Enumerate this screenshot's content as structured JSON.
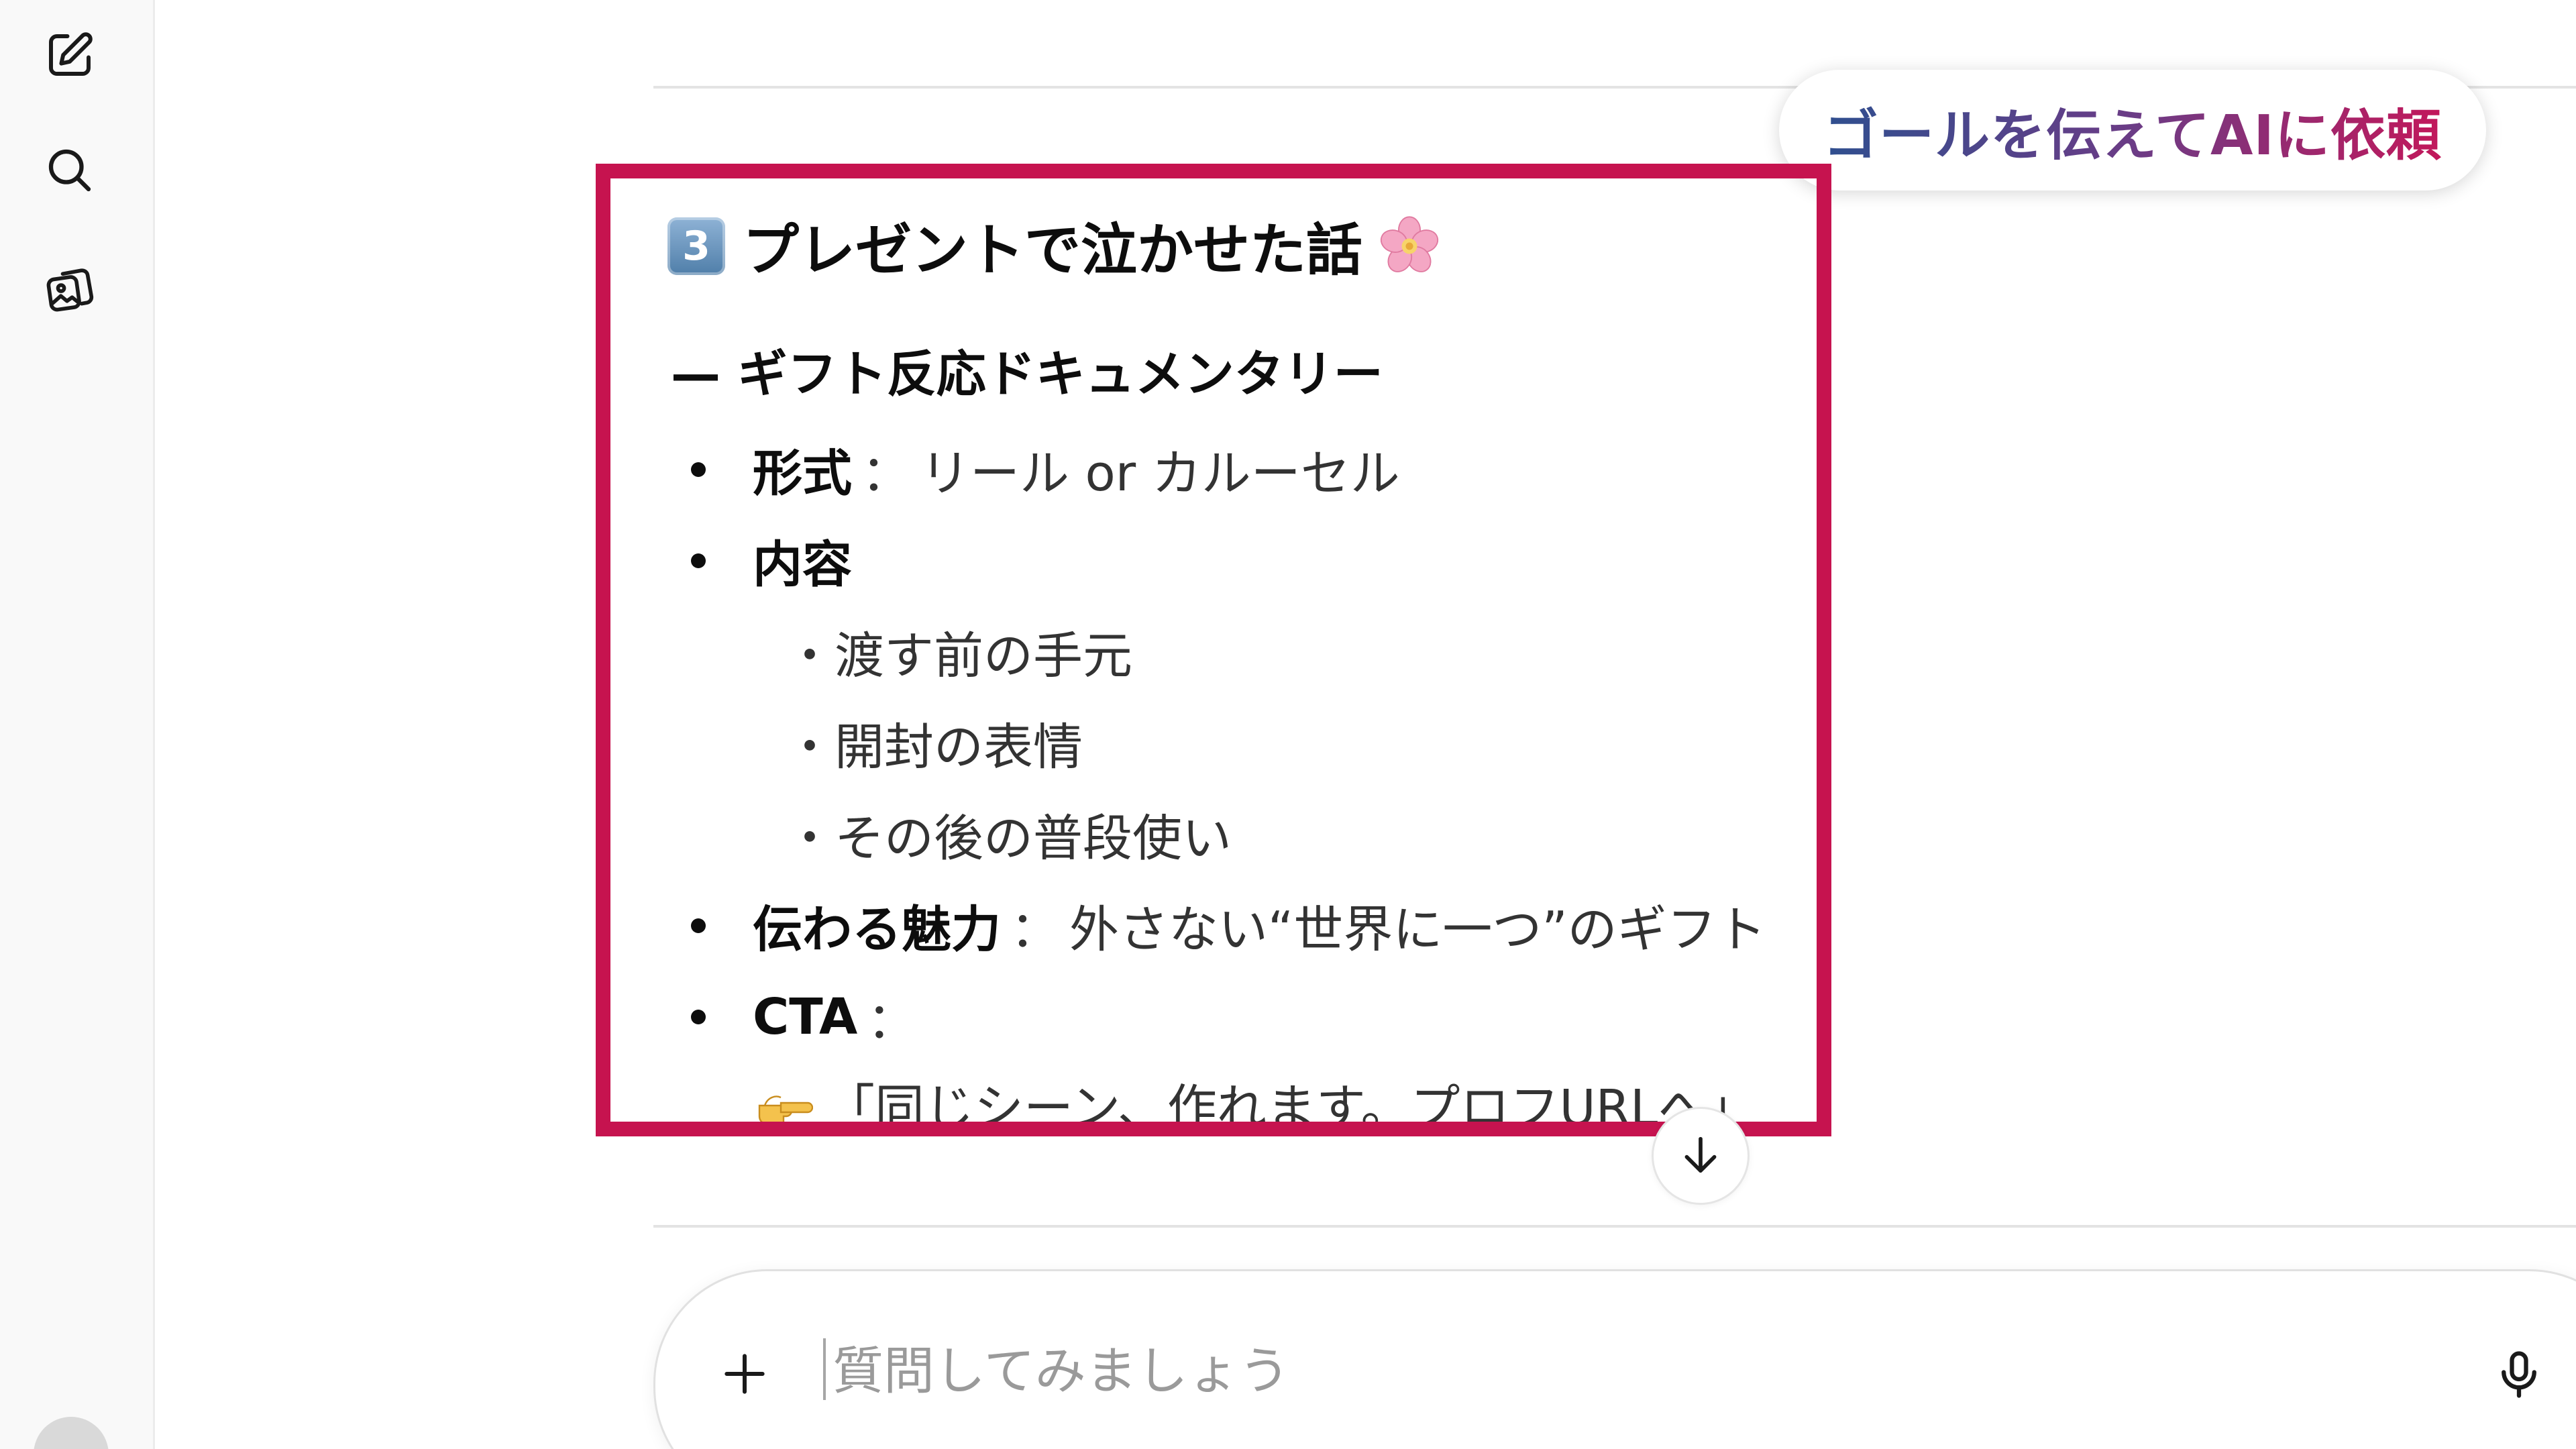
{
  "sidebar": {
    "new_chat_icon": "square-pen-icon",
    "search_icon": "search-icon",
    "images_icon": "image-library-icon"
  },
  "callout": {
    "text": "ゴールを伝えてAIに依頼",
    "gradient_colors": [
      "#2f4f8f",
      "#6b3c86",
      "#c2185b"
    ]
  },
  "highlight": {
    "border_color": "#c6134f"
  },
  "message": {
    "keycap": "3",
    "title": "プレゼントで泣かせた話",
    "title_emoji": "cherry-blossom-emoji",
    "subtitle": "— ギフト反応ドキュメンタリー",
    "bullets": [
      {
        "label": "形式",
        "separator": "：",
        "value": "リール or カルーセル"
      },
      {
        "label": "内容",
        "separator": "",
        "value": ""
      },
      {
        "label": "伝わる魅力",
        "separator": "：",
        "value": "外さない“世界に一つ”のギフト"
      },
      {
        "label": "CTA",
        "separator": "：",
        "value": ""
      }
    ],
    "content_items": [
      "・渡す前の手元",
      "・開封の表情",
      "・その後の普段使い"
    ],
    "cta_emoji": "pointing-right-emoji",
    "cta_text": "「同じシーン、作れます。プロフURLへ」"
  },
  "scroll_button": {
    "icon": "arrow-down-icon"
  },
  "composer": {
    "placeholder": "質問してみましょう",
    "value": "",
    "plus_icon": "plus-icon",
    "mic_icon": "microphone-icon"
  }
}
